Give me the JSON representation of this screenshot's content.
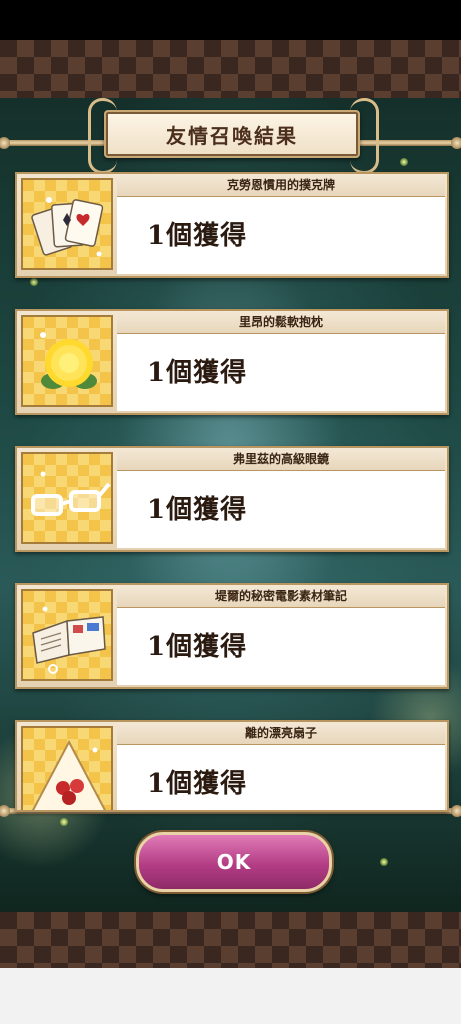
{
  "dialog": {
    "title": "友情召喚結果",
    "ok_label": "OK"
  },
  "results": [
    {
      "name": "克勞恩慣用的撲克牌",
      "count_text": "1個獲得",
      "icon": "playing-cards-icon"
    },
    {
      "name": "里昂的鬆軟抱枕",
      "count_text": "1個獲得",
      "icon": "fluffy-pillow-icon"
    },
    {
      "name": "弗里茲的高級眼鏡",
      "count_text": "1個獲得",
      "icon": "glasses-icon"
    },
    {
      "name": "堤爾的秘密電影素材筆記",
      "count_text": "1個獲得",
      "icon": "notebook-icon"
    },
    {
      "name": "離的漂亮扇子",
      "count_text": "1個獲得",
      "icon": "fan-icon"
    }
  ],
  "colors": {
    "ok_button": "#b43d85",
    "frame_gold": "#b99660",
    "icon_background": "#f3c34a"
  }
}
